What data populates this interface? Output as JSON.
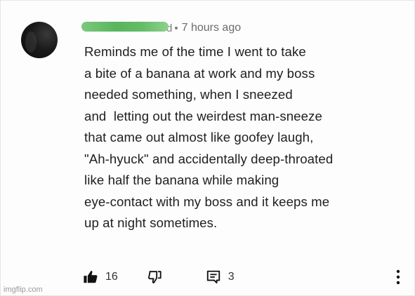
{
  "comment": {
    "author_suffix": "d",
    "separator": "•",
    "timestamp": "7 hours ago",
    "lines": [
      "Reminds me of the time I went to take",
      "a bite of a banana at work and my boss",
      "needed something, when I sneezed",
      "and  letting out the weirdest man-sneeze",
      "that came out almost like goofey laugh,",
      "\"Ah-hyuck\" and accidentally deep-throated",
      "like half the banana while making",
      "eye-contact with my boss and it keeps me",
      "up at night sometimes."
    ]
  },
  "actions": {
    "like_icon": "thumbs-up-icon",
    "like_count": "16",
    "dislike_icon": "thumbs-down-icon",
    "reply_icon": "reply-icon",
    "reply_count": "3",
    "more_icon": "more-vertical-icon"
  },
  "colors": {
    "redaction": "#5cb860",
    "text": "#202020",
    "meta": "#6b6b6b"
  },
  "watermark": "imgflip.com"
}
